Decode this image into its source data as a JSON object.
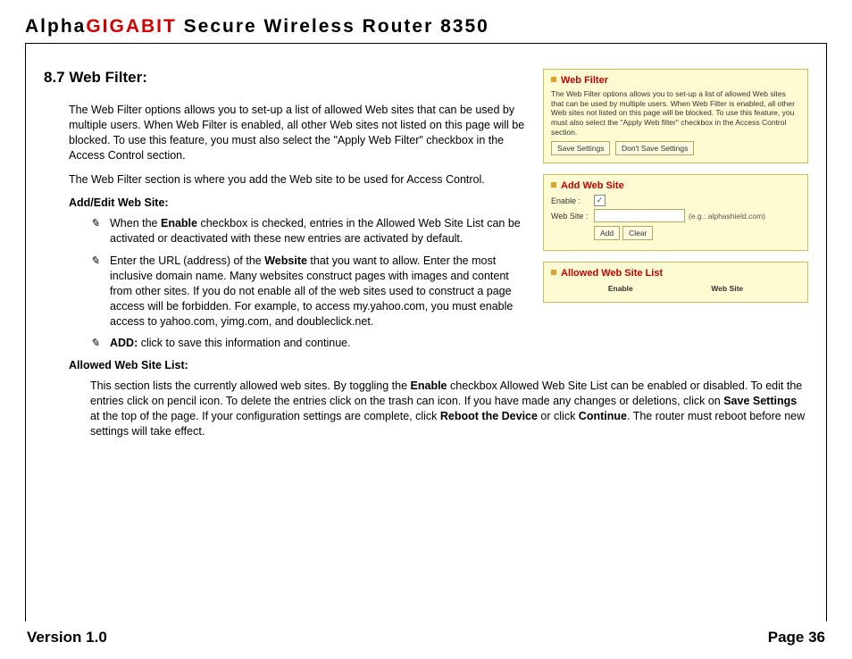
{
  "header": {
    "brand_prefix": "Alpha",
    "brand_highlight": "GIGABIT",
    "brand_suffix": " Secure Wireless Router 8350"
  },
  "section": {
    "number_title": "8.7 Web Filter:",
    "intro_para_1": "The Web Filter options allows you to set-up a list of allowed Web sites that can be used by multiple users. When Web Filter is enabled, all other  Web sites not listed on this page will be blocked. To use this feature, you must also select the \"Apply Web Filter\" checkbox in the Access Control section.",
    "intro_para_2": "The Web Filter section is where you add the Web site to be used for Access Control.",
    "addedit_heading": "Add/Edit Web Site:",
    "bullets": [
      {
        "pre": "When the ",
        "bold1": "Enable",
        "post1": " checkbox is checked, entries in the Allowed Web Site List can be activated or deactivated with these new entries are activated by default."
      },
      {
        "pre": "Enter the URL (address) of the ",
        "bold1": "Website",
        "post1": " that you want to allow. Enter the most inclusive domain name.  Many websites construct pages with images and content from other sites. If you do not enable all of the web sites used to construct a page access will be forbidden. For example, to access my.yahoo.com, you must enable access to yahoo.com, yimg.com, and doubleclick.net."
      },
      {
        "bold1": "ADD:",
        "post1": " click to save this information and continue."
      }
    ],
    "allowed_heading": "Allowed Web Site List:",
    "allowed_para": {
      "t1": "This section lists the currently allowed web sites. By toggling the ",
      "b1": "Enable",
      "t2": " checkbox Allowed Web Site List can be enabled or disabled. To edit the entries click on pencil icon. To delete the entries click on the trash can icon. If you have made any changes or deletions, click on ",
      "b2": "Save Settings",
      "t3": " at the top of the page. If your configuration settings are complete, click ",
      "b3": "Reboot the Device",
      "t4": " or click ",
      "b4": "Continue",
      "t5": ". The router must reboot before new settings will take effect."
    }
  },
  "panel": {
    "box1": {
      "title": "Web Filter",
      "desc": "The Web Filter options allows you to set-up a list of allowed Web sites that can be used by multiple users. When Web Filter is enabled, all other Web sites not listed on this page will be blocked. To use this feature, you must also select the \"Apply Web filter\" checkbox in the Access Control section.",
      "btn_save": "Save Settings",
      "btn_dont": "Don't Save Settings"
    },
    "box2": {
      "title": "Add Web Site",
      "lbl_enable": "Enable :",
      "enable_checked": "✓",
      "lbl_website": "Web Site :",
      "hint": "(e.g.: alphashield.com)",
      "btn_add": "Add",
      "btn_clear": "Clear"
    },
    "box3": {
      "title": "Allowed Web Site List",
      "col_enable": "Enable",
      "col_website": "Web Site"
    }
  },
  "footer": {
    "version": "Version 1.0",
    "page": "Page 36"
  }
}
